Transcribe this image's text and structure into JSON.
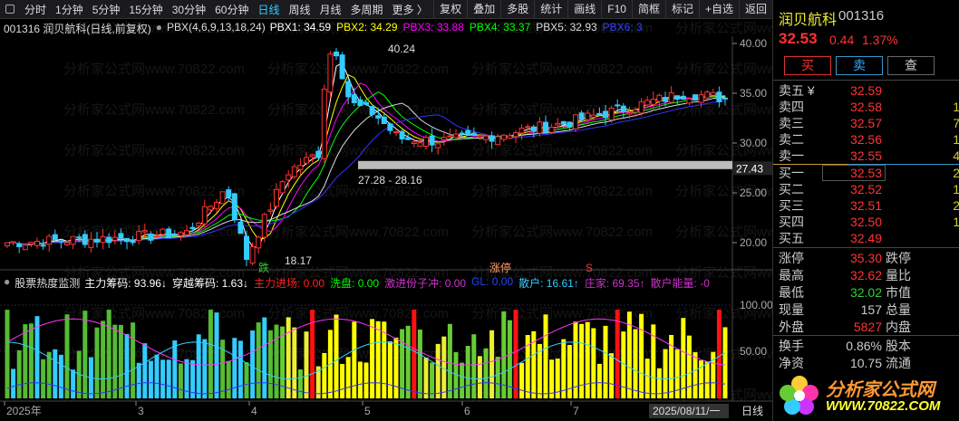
{
  "toolbar": {
    "periods": [
      "分时",
      "1分钟",
      "5分钟",
      "15分钟",
      "30分钟",
      "60分钟",
      "日线",
      "周线",
      "月线",
      "多周期",
      "更多 〉"
    ],
    "active": "日线",
    "actions": [
      "复权",
      "叠加",
      "多股",
      "统计",
      "画线",
      "F10",
      "简框",
      "标记",
      "+自选",
      "返回"
    ]
  },
  "chart_info": {
    "title": "001316 润贝航科(日线,前复权)",
    "indicator": "PBX(4,6,9,13,18,24)",
    "pbx": [
      {
        "label": "PBX1: 34.59",
        "color": "#ffffff"
      },
      {
        "label": "PBX2: 34.29",
        "color": "#ffff00"
      },
      {
        "label": "PBX3: 33.88",
        "color": "#ff00ff"
      },
      {
        "label": "PBX4: 33.37",
        "color": "#00ff00"
      },
      {
        "label": "PBX5: 32.93",
        "color": "#dddddd"
      },
      {
        "label": "PBX6: 3",
        "color": "#3344ff"
      }
    ]
  },
  "price_axis": [
    "40.00",
    "35.00",
    "30.00",
    "25.00",
    "20.00"
  ],
  "price_labels": {
    "high": "40.24",
    "low": "18.17",
    "range": "27.28 - 28.16",
    "current": "27.43"
  },
  "markers": {
    "die": "跌",
    "zhangting": "涨停",
    "s": "S"
  },
  "indicator_info": {
    "name": "股票热度监测",
    "items": [
      {
        "label": "主力筹码: 93.96↓",
        "color": "#ffffff"
      },
      {
        "label": "穿越筹码: 1.63↓",
        "color": "#ffffff"
      },
      {
        "label": "主力进场: 0.00",
        "color": "#ff2222"
      },
      {
        "label": "洗盘: 0.00",
        "color": "#00ff00"
      },
      {
        "label": "激进份子冲: 0.00",
        "color": "#cc33cc"
      },
      {
        "label": "GL: 0.00",
        "color": "#2244ff"
      },
      {
        "label": "散户: 16.61↑",
        "color": "#33ccff"
      },
      {
        "label": "庄家: 69.35↑",
        "color": "#cc33cc"
      },
      {
        "label": "散户能量: -0",
        "color": "#cc33cc"
      }
    ]
  },
  "ind_axis": [
    "100.00",
    "50.00"
  ],
  "time_axis": {
    "labels": [
      "2025年",
      "3",
      "4",
      "5",
      "6",
      "7"
    ],
    "current": "2025/08/11/一",
    "period": "日线"
  },
  "chart_data": {
    "type": "candlestick",
    "price_path": [
      [
        0,
        20
      ],
      [
        30,
        20.5
      ],
      [
        45,
        21
      ],
      [
        55,
        25.5
      ],
      [
        60,
        18.5
      ],
      [
        70,
        27
      ],
      [
        78,
        29
      ],
      [
        80,
        38
      ],
      [
        82,
        40
      ],
      [
        86,
        34
      ],
      [
        92,
        33
      ],
      [
        98,
        30.5
      ],
      [
        108,
        30.2
      ],
      [
        118,
        30.5
      ],
      [
        125,
        31
      ],
      [
        140,
        32
      ],
      [
        155,
        33.5
      ],
      [
        170,
        35
      ],
      [
        180,
        34.5
      ]
    ],
    "ylim": [
      17,
      42
    ]
  },
  "quote": {
    "name": "润贝航科",
    "code": "001316",
    "price": "32.53",
    "change": "0.44",
    "pct": "1.37%",
    "buttons": [
      "买",
      "卖",
      "查"
    ],
    "asks": [
      {
        "label": "卖五 ¥",
        "price": "32.59",
        "qty": ""
      },
      {
        "label": "卖四",
        "price": "32.58",
        "qty": "1"
      },
      {
        "label": "卖三",
        "price": "32.57",
        "qty": "7"
      },
      {
        "label": "卖二",
        "price": "32.56",
        "qty": "1"
      },
      {
        "label": "卖一",
        "price": "32.55",
        "qty": "4"
      }
    ],
    "bids": [
      {
        "label": "买一",
        "price": "32.53",
        "qty": "2"
      },
      {
        "label": "买二",
        "price": "32.52",
        "qty": "1"
      },
      {
        "label": "买三",
        "price": "32.51",
        "qty": "2"
      },
      {
        "label": "买四",
        "price": "32.50",
        "qty": "1"
      },
      {
        "label": "买五",
        "price": "32.49",
        "qty": ""
      }
    ],
    "stats": [
      {
        "l": "涨停",
        "v": "35.30",
        "c": "#f33",
        "l2": "跌停"
      },
      {
        "l": "最高",
        "v": "32.62",
        "c": "#f33",
        "l2": "量比"
      },
      {
        "l": "最低",
        "v": "32.02",
        "c": "#3c3",
        "l2": "市值"
      },
      {
        "l": "现量",
        "v": "157",
        "c": "#ccc",
        "l2": "总量"
      },
      {
        "l": "外盘",
        "v": "5827",
        "c": "#f33",
        "l2": "内盘"
      }
    ],
    "stats2": [
      {
        "l": "换手",
        "v": "0.86%",
        "c": "#ccc",
        "l2": "股本"
      },
      {
        "l": "净资",
        "v": "10.75",
        "c": "#ccc",
        "l2": "流通"
      }
    ]
  },
  "logo": {
    "text": "分析家公式网",
    "url": "WWW.70822.COM"
  },
  "watermark": "分析家公式网www.70822.com"
}
